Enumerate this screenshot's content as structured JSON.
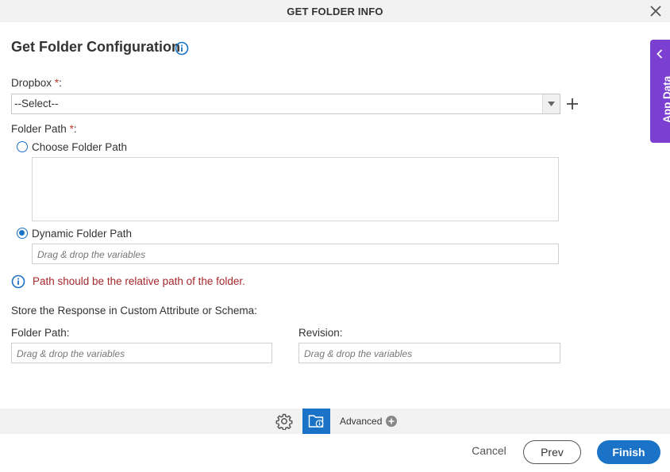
{
  "dialog": {
    "title": "GET FOLDER INFO"
  },
  "heading": "Get Folder Configuration",
  "dropbox": {
    "label": "Dropbox",
    "required_mark": "*",
    "suffix": ":",
    "selected": "--Select--"
  },
  "folder_path": {
    "label": "Folder Path",
    "required_mark": "*",
    "suffix": ":",
    "options": [
      {
        "label": "Choose Folder Path",
        "selected": false
      },
      {
        "label": "Dynamic Folder Path",
        "selected": true
      }
    ],
    "dynamic_placeholder": "Drag & drop the variables"
  },
  "note": "Path should be the relative path of the folder.",
  "store": {
    "section_label": "Store the Response in Custom Attribute or Schema:",
    "folder_path_label": "Folder Path:",
    "folder_path_placeholder": "Drag & drop the variables",
    "revision_label": "Revision:",
    "revision_placeholder": "Drag & drop the variables"
  },
  "app_data_tab": "App Data",
  "toolbar": {
    "advanced_label": "Advanced"
  },
  "footer": {
    "cancel": "Cancel",
    "prev": "Prev",
    "finish": "Finish"
  },
  "icons": {
    "close": "close-icon",
    "info": "info-icon",
    "dropdown": "triangle-down-icon",
    "add": "plus-icon",
    "gear": "gear-icon",
    "folder_info": "folder-info-icon",
    "advanced_add": "plus-circle-icon",
    "collapse": "chevron-left-icon"
  },
  "colors": {
    "primary": "#1a73c7",
    "app_data": "#7b3fd1",
    "note": "#a5282b",
    "required": "#c0392b"
  }
}
